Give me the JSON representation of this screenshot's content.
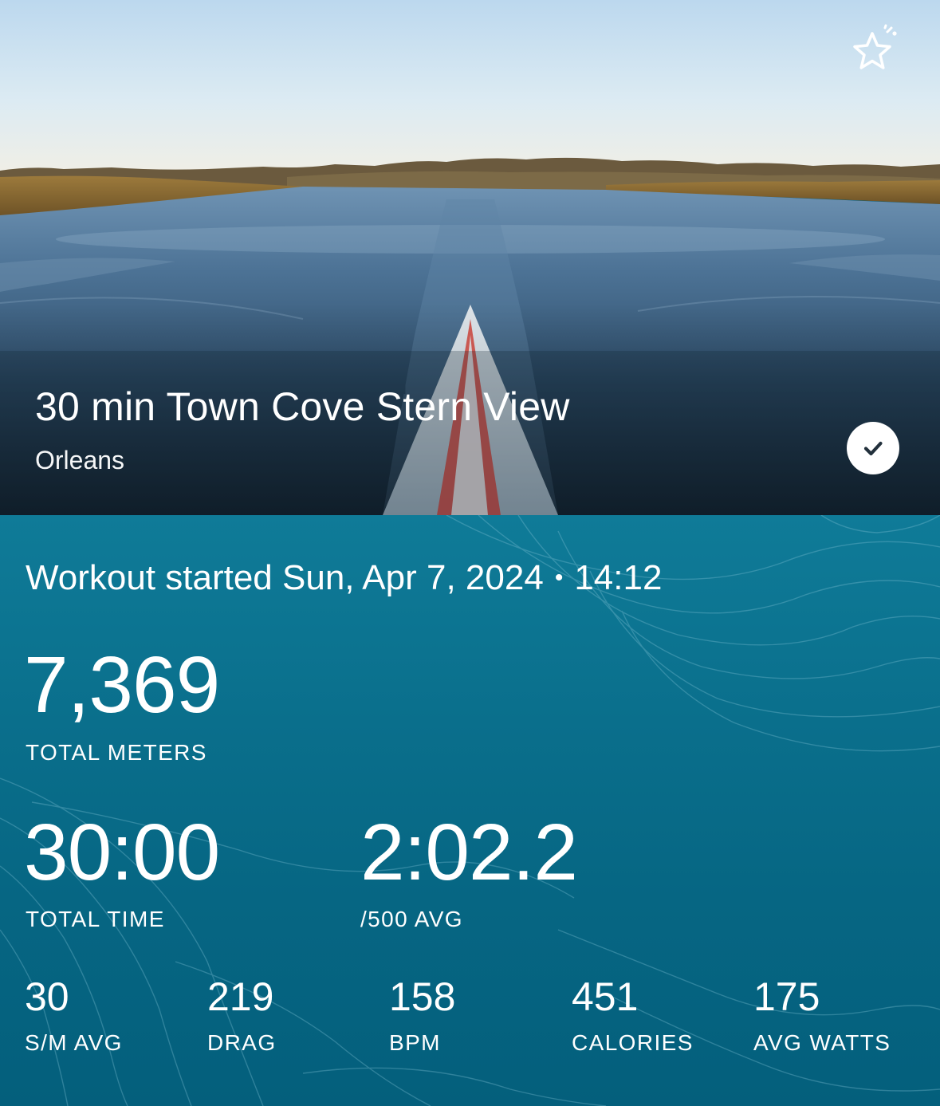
{
  "hero": {
    "title": "30 min Town Cove Stern View",
    "location": "Orleans",
    "favorite_icon": "star-sparkle-icon",
    "completed_icon": "checkmark-icon"
  },
  "workout": {
    "started_prefix": "Workout started",
    "date": "Sun, Apr 7, 2024",
    "separator": "•",
    "time": "14:12"
  },
  "primary_stat": {
    "value": "7,369",
    "label": "TOTAL METERS"
  },
  "secondary_stats": [
    {
      "value": "30:00",
      "label": "TOTAL TIME"
    },
    {
      "value": "2:02.2",
      "label": "/500 AVG"
    }
  ],
  "tertiary_stats": [
    {
      "value": "30",
      "label": "S/M AVG"
    },
    {
      "value": "219",
      "label": "DRAG"
    },
    {
      "value": "158",
      "label": "BPM"
    },
    {
      "value": "451",
      "label": "CALORIES"
    },
    {
      "value": "175",
      "label": "AVG WATTS"
    }
  ],
  "colors": {
    "panel_top": "#0f7b98",
    "panel_bottom": "#045f7c",
    "text": "#ffffff"
  }
}
